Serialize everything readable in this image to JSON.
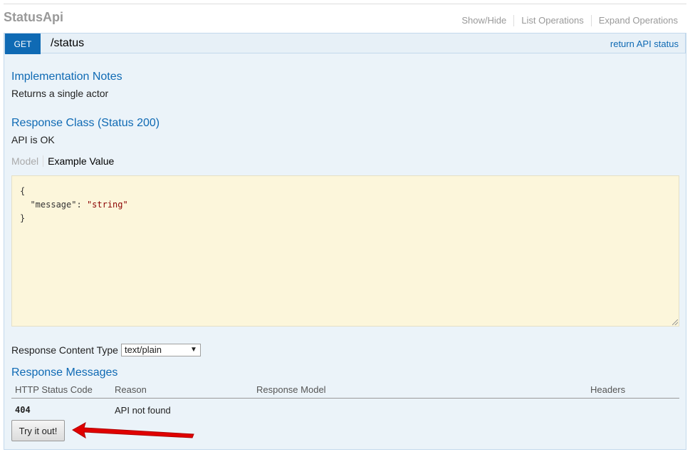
{
  "resource": {
    "title": "StatusApi",
    "links": [
      "Show/Hide",
      "List Operations",
      "Expand Operations"
    ]
  },
  "operation": {
    "method": "GET",
    "path": "/status",
    "summary": "return API status",
    "impl_heading": "Implementation Notes",
    "impl_text": "Returns a single actor",
    "response_class_heading": "Response Class (Status 200)",
    "response_class_text": "API is OK",
    "tabs": {
      "model": "Model",
      "example": "Example Value"
    },
    "example": {
      "key": "\"message\"",
      "value": "\"string\""
    },
    "content_type_label": "Response Content Type",
    "content_type_value": "text/plain",
    "response_messages_heading": "Response Messages",
    "table": {
      "headers": [
        "HTTP Status Code",
        "Reason",
        "Response Model",
        "Headers"
      ],
      "rows": [
        {
          "code": "404",
          "reason": "API not found",
          "model": "",
          "headers": ""
        }
      ]
    },
    "try_button": "Try it out!"
  },
  "colors": {
    "accent": "#0f6ab4",
    "annotation_arrow": "#e00000"
  }
}
